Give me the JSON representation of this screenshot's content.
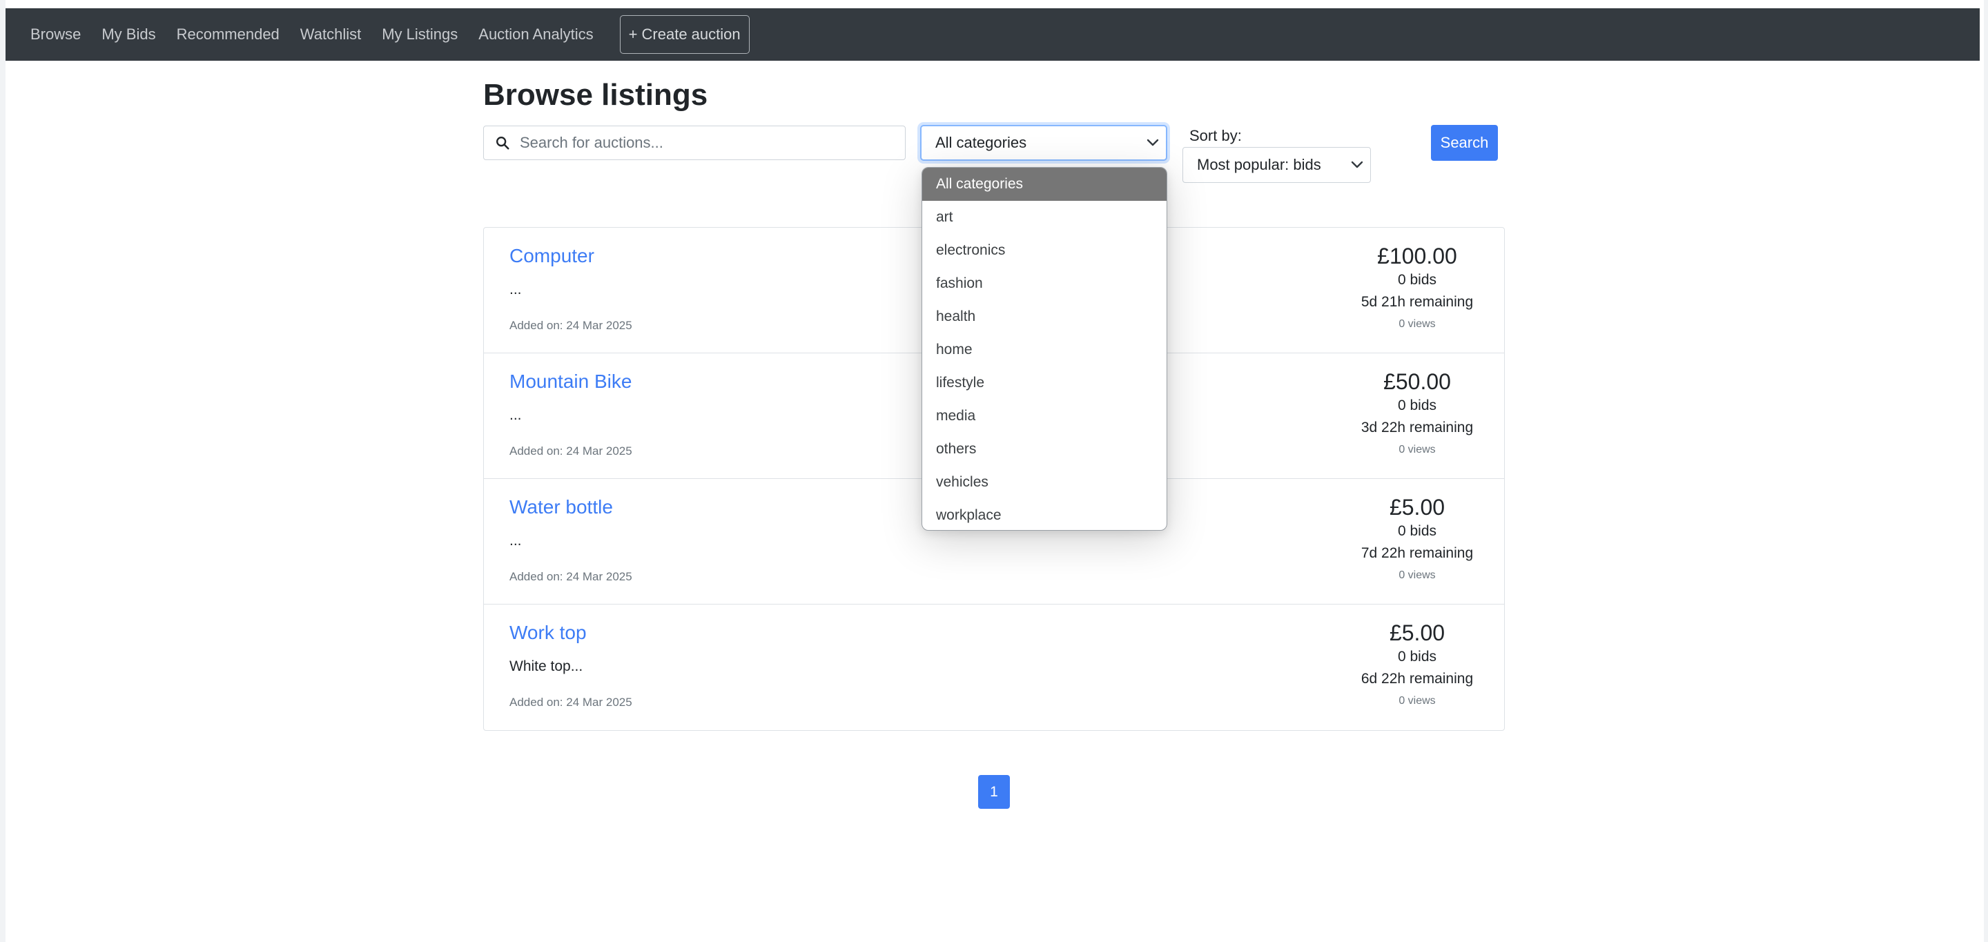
{
  "nav": {
    "items": [
      "Browse",
      "My Bids",
      "Recommended",
      "Watchlist",
      "My Listings",
      "Auction Analytics"
    ],
    "create_label": "+ Create auction"
  },
  "page": {
    "title": "Browse listings"
  },
  "search": {
    "placeholder": "Search for auctions...",
    "button_label": "Search"
  },
  "category": {
    "selected": "All categories",
    "options": [
      "All categories",
      "art",
      "electronics",
      "fashion",
      "health",
      "home",
      "lifestyle",
      "media",
      "others",
      "vehicles",
      "workplace"
    ]
  },
  "sort": {
    "label": "Sort by:",
    "selected": "Most popular: bids"
  },
  "listings": [
    {
      "title": "Computer",
      "desc": "...",
      "date": "Added on: 24 Mar 2025",
      "price": "£100.00",
      "bids": "0 bids",
      "remaining": "5d 21h remaining",
      "views": "0 views"
    },
    {
      "title": "Mountain Bike",
      "desc": "...",
      "date": "Added on: 24 Mar 2025",
      "price": "£50.00",
      "bids": "0 bids",
      "remaining": "3d 22h remaining",
      "views": "0 views"
    },
    {
      "title": "Water bottle",
      "desc": "...",
      "date": "Added on: 24 Mar 2025",
      "price": "£5.00",
      "bids": "0 bids",
      "remaining": "7d 22h remaining",
      "views": "0 views"
    },
    {
      "title": "Work top",
      "desc": "White top...",
      "date": "Added on: 24 Mar 2025",
      "price": "£5.00",
      "bids": "0 bids",
      "remaining": "6d 22h remaining",
      "views": "0 views"
    }
  ],
  "pagination": {
    "current": "1"
  },
  "icons": {
    "search": "search-icon",
    "chevron": "chevron-down-icon"
  },
  "colors": {
    "navbar": "#343a40",
    "primary": "#3d7cf5",
    "selected_option": "#767676"
  }
}
